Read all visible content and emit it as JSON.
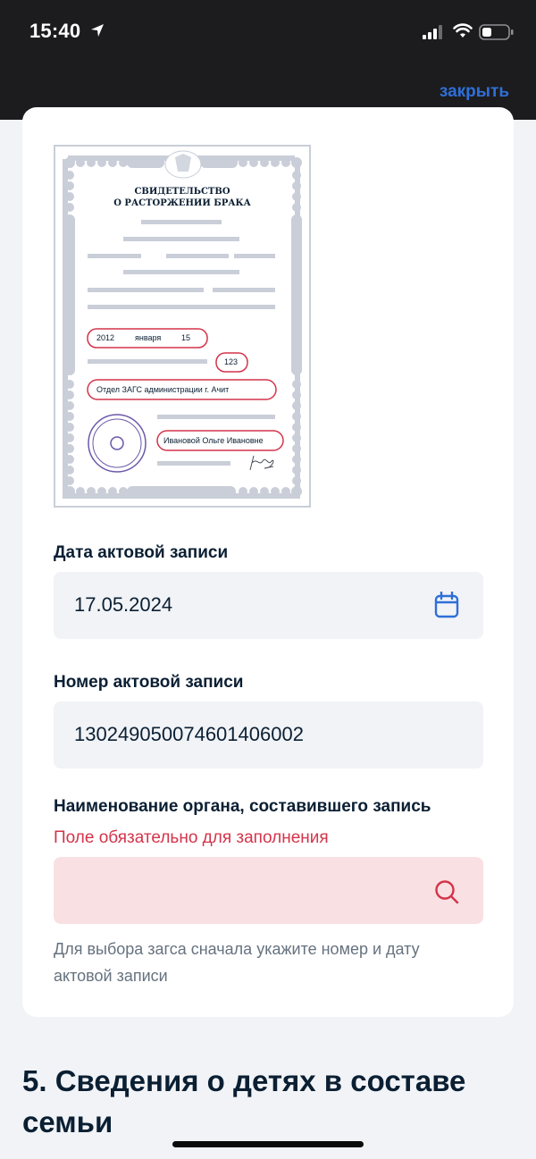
{
  "status_bar": {
    "time": "15:40"
  },
  "header": {
    "close_label": "закрыть",
    "accent_color": "#2f6fd8"
  },
  "certificate": {
    "title_line1": "СВИДЕТЕЛЬСТВО",
    "title_line2": "О РАСТОРЖЕНИИ БРАКА",
    "date_year": "2012",
    "date_month": "января",
    "date_day": "15",
    "record_number": "123",
    "office": "Отдел ЗАГС администрации г. Ачит",
    "recipient": "Ивановой Ольге Ивановне"
  },
  "fields": {
    "record_date": {
      "label": "Дата актовой записи",
      "value": "17.05.2024",
      "icon": "calendar-icon"
    },
    "record_number": {
      "label": "Номер актовой записи",
      "value": "130249050074601406002"
    },
    "authority": {
      "label": "Наименование органа, составившего запись",
      "error": "Поле обязательно для заполнения",
      "value": "",
      "icon": "search-icon",
      "hint": "Для выбора загса сначала укажите номер и дату актовой записи"
    }
  },
  "next_section": {
    "title": "5. Сведения о детях в составе семьи"
  },
  "colors": {
    "error": "#d3344a",
    "error_bg": "#f9e0e2",
    "field_bg": "#f1f3f6",
    "text": "#0b1f33"
  }
}
